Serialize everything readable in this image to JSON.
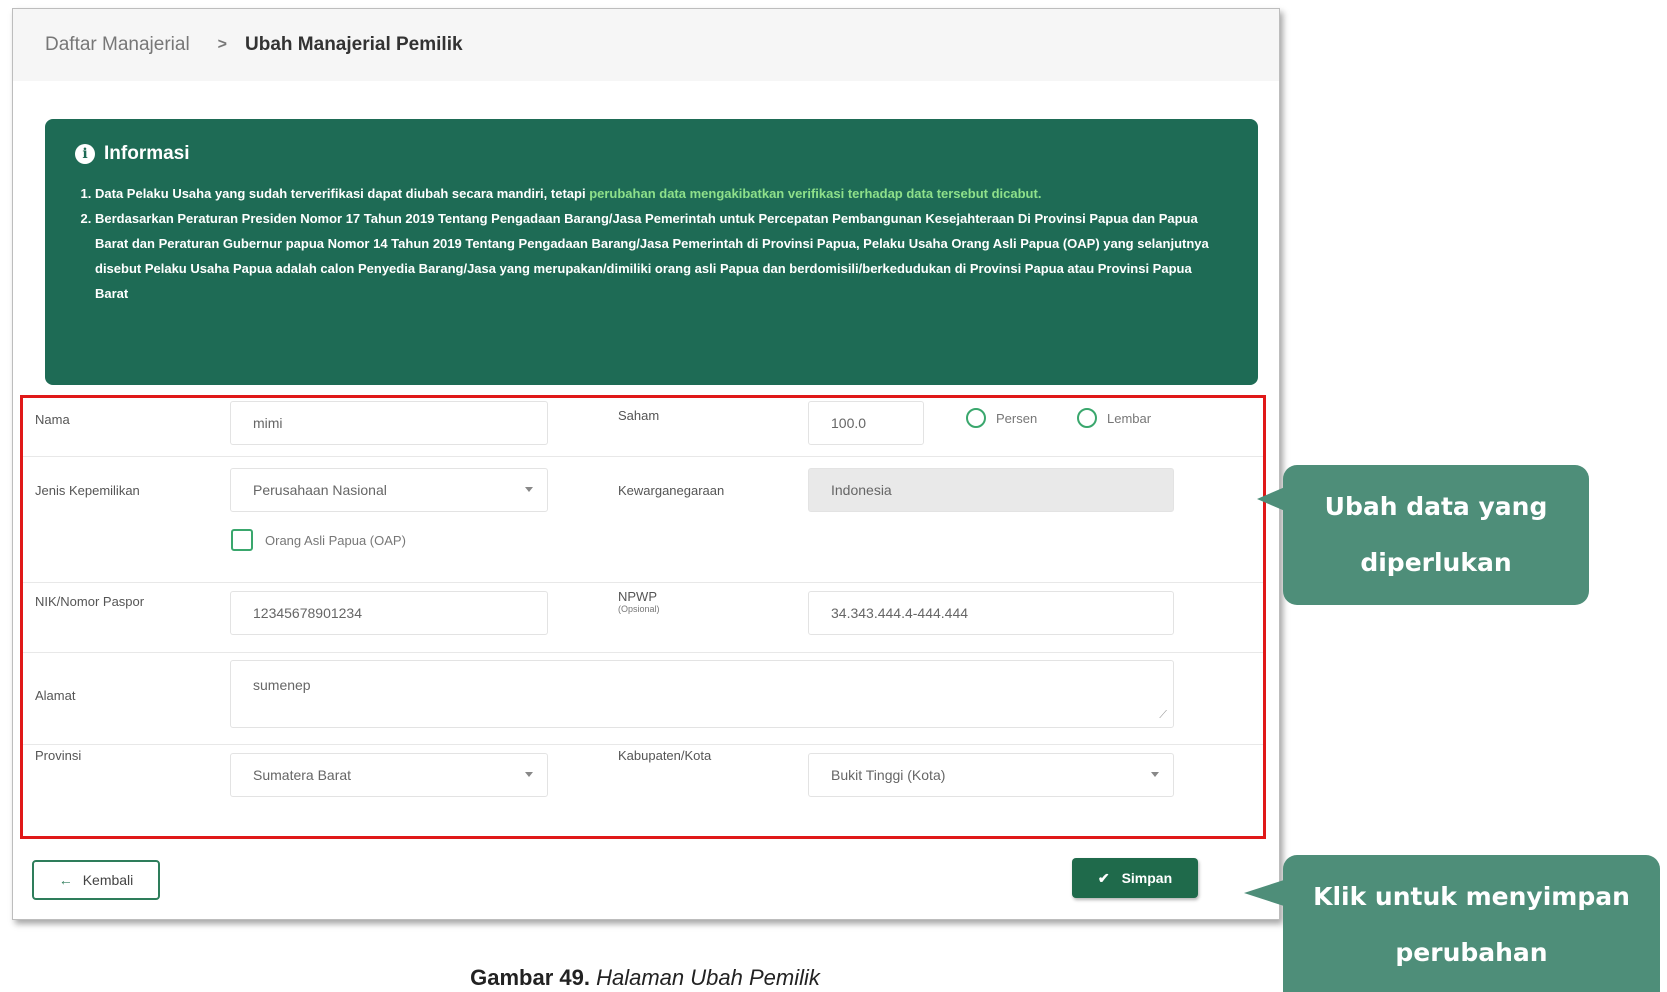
{
  "breadcrumb": {
    "parent": "Daftar Manajerial",
    "separator": ">",
    "current": "Ubah Manajerial Pemilik"
  },
  "info": {
    "title": "Informasi",
    "item1_a": "Data Pelaku Usaha yang sudah terverifikasi dapat diubah secara mandiri, tetapi ",
    "item1_hl": "perubahan data mengakibatkan verifikasi terhadap data tersebut dicabut.",
    "item2": "Berdasarkan Peraturan Presiden Nomor 17 Tahun 2019 Tentang Pengadaan Barang/Jasa Pemerintah untuk Percepatan Pembangunan Kesejahteraan Di Provinsi Papua dan Papua Barat dan Peraturan Gubernur papua Nomor 14 Tahun 2019 Tentang Pengadaan Barang/Jasa Pemerintah di Provinsi Papua, Pelaku Usaha Orang Asli Papua (OAP) yang selanjutnya disebut Pelaku Usaha Papua adalah calon Penyedia Barang/Jasa yang merupakan/dimiliki orang asli Papua dan berdomisili/berkedudukan di Provinsi Papua atau Provinsi Papua Barat"
  },
  "form": {
    "nama": {
      "label": "Nama",
      "value": "mimi"
    },
    "saham": {
      "label": "Saham",
      "value": "100.0",
      "option1": "Persen",
      "option2": "Lembar"
    },
    "jenis": {
      "label": "Jenis Kepemilikan",
      "value": "Perusahaan Nasional"
    },
    "kewarganegaraan": {
      "label": "Kewarganegaraan",
      "value": "Indonesia"
    },
    "oap": {
      "label": "Orang Asli Papua (OAP)"
    },
    "nik": {
      "label": "NIK/Nomor Paspor",
      "value": "12345678901234"
    },
    "npwp": {
      "label": "NPWP",
      "note": "(Opsional)",
      "value": "34.343.444.4-444.444"
    },
    "alamat": {
      "label": "Alamat",
      "value": "sumenep"
    },
    "provinsi": {
      "label": "Provinsi",
      "value": "Sumatera Barat"
    },
    "kabupaten": {
      "label": "Kabupaten/Kota",
      "value": "Bukit Tinggi (Kota)"
    }
  },
  "buttons": {
    "back": "Kembali",
    "save": "Simpan"
  },
  "callouts": {
    "edit_line1": "Ubah data yang",
    "edit_line2": "diperlukan",
    "save_line1": "Klik untuk menyimpan",
    "save_line2": "perubahan"
  },
  "caption": {
    "bold": "Gambar 49.",
    "italic": "Halaman Ubah Pemilik"
  },
  "colors": {
    "accent": "#1e6b55",
    "highlight": "#e01818",
    "callout": "#4e8e79"
  }
}
